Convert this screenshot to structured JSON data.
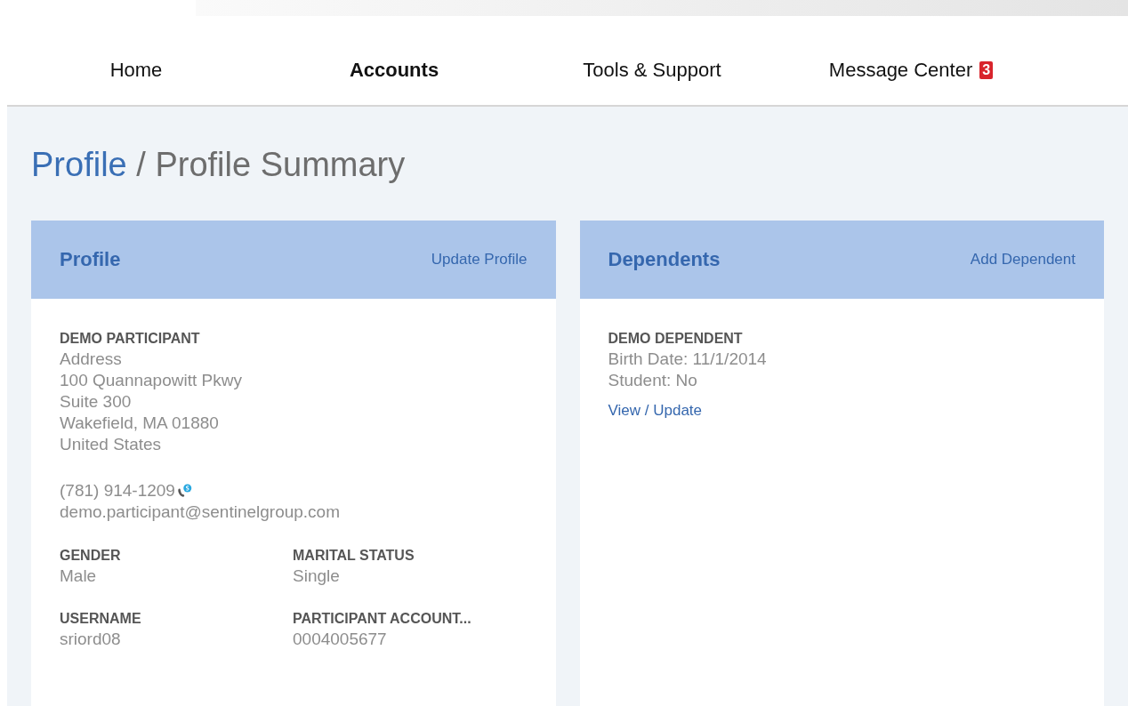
{
  "nav": {
    "items": [
      {
        "label": "Home",
        "selected": false
      },
      {
        "label": "Accounts",
        "selected": true
      },
      {
        "label": "Tools & Support",
        "selected": false
      },
      {
        "label": "Message Center",
        "selected": false,
        "badge": "3"
      }
    ]
  },
  "breadcrumb": {
    "parent": "Profile",
    "current": "/ Profile Summary"
  },
  "profile_card": {
    "title": "Profile",
    "action": "Update Profile",
    "name": "DEMO PARTICIPANT",
    "address_lines": [
      "Address",
      "100 Quannapowitt Pkwy",
      "Suite 300",
      "Wakefield, MA 01880",
      "United States"
    ],
    "phone": "(781) 914-1209",
    "email": "demo.participant@sentinelgroup.com",
    "fields": [
      {
        "label": "GENDER",
        "value": "Male"
      },
      {
        "label": "MARITAL STATUS",
        "value": "Single"
      },
      {
        "label": "USERNAME",
        "value": "sriord08"
      },
      {
        "label": "PARTICIPANT ACCOUNT...",
        "value": "0004005677"
      }
    ]
  },
  "dependents_card": {
    "title": "Dependents",
    "action": "Add Dependent",
    "dependents": [
      {
        "name": "DEMO DEPENDENT",
        "lines": [
          "Birth Date: 11/1/2014",
          "Student: No"
        ],
        "link": "View / Update"
      }
    ]
  }
}
